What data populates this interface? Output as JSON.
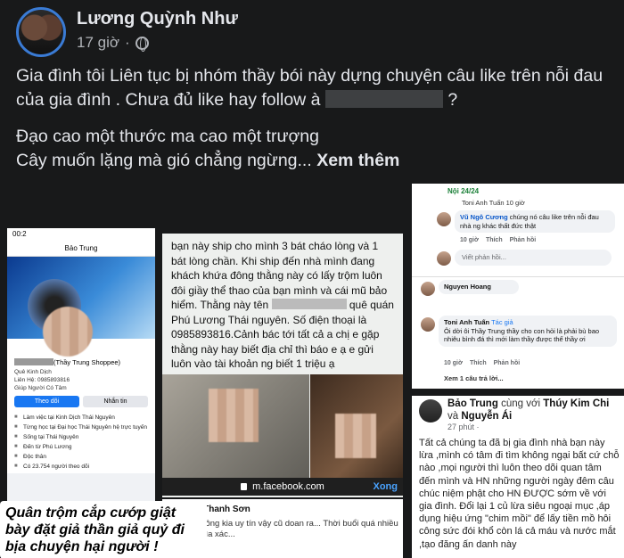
{
  "post": {
    "author": "Lương Quỳnh Như",
    "time": "17 giờ",
    "separator": "·",
    "text_line1_a": "Gia đình tôi  Liên tục bị nhóm thầy bói này dựng chuyện câu like trên nỗi đau của gia đình . Chưa đủ like hay follow à",
    "text_line1_b": "?",
    "text_line2": "Đạo cao một thước ma cao một trượng",
    "text_line3": "Cây muốn lặng mà gió chẳng ngừng...",
    "see_more": "Xem thêm"
  },
  "phone_screenshot": {
    "status_time": "00:2",
    "title": "Bảo Trung",
    "name_suffix": "(Thầy Trung Shoppee)",
    "info": [
      "Quê Kinh Dịch",
      "Liên Hệ: 0985893816",
      "Giúp Người Có Tâm"
    ],
    "follow_label": "Theo dõi",
    "message_label": "Nhắn tin",
    "list": [
      "Làm việc tại Kinh Dịch Thái Nguyên",
      "Từng học tại Đại học Thái Nguyên hệ trực tuyến",
      "Sống tại Thái Nguyên",
      "Đến từ Phú Lương",
      "Độc thân",
      "Có 23.754 người theo dõi"
    ],
    "caption": "Quân trộm cắp cướp giật bày đặt giả thần giả quỷ đi bịa chuyện hại người !"
  },
  "note_screenshot": {
    "text_a": "bạn này ship cho mình 3 bát cháo lòng và 1 bát lòng chần. Khi ship đến nhà mình đang khách khứa đông thằng này có lấy trộm luôn đôi giầy thể thao của bạn mình và cái mũ bảo hiểm. Thằng này tên",
    "text_b": "quê quán Phú Lương Thái nguyên. Số điện thoại là 0985893816.Cảnh bác tới tất cả a chị e gặp thằng này hay biết địa chỉ thì báo e ạ e gửi luôn vào tài khoản ng biết 1 triệu ạ",
    "url": "m.facebook.com",
    "done": "Xong"
  },
  "comment_card": {
    "name": "Cổ Thanh Sơn",
    "text": "mặt ông kia uy tín vậy cũ doan ra... Thời buổi quá nhiều lên rìa xác..."
  },
  "comments_screenshot": {
    "group": "Nội 24/24",
    "top_line": "Toni Anh Tuấn  10 giờ",
    "c1_name": "Vũ Ngô Cương",
    "c1_text": "chúng nó câu like trên nỗi đau nhà ng khác thất đức thật",
    "acts_time": "10 giờ",
    "act_like": "Thích",
    "act_reply": "Phản hồi",
    "reply_placeholder": "Viết phản hồi...",
    "c2_name": "Nguyen Hoang",
    "c3_name": "Toni Anh Tuấn",
    "c3_badge": "Tác giả",
    "c3_text": "Ôi dời ôi Thầy Trung thầy cho con hỏi là phải bù bao nhiêu bình đá thì mới làm thầy được thế thầy ơi",
    "c3_time": "10 giờ",
    "more_replies": "Xem 1 câu trả lời..."
  },
  "fb_post_screenshot": {
    "author": "Bảo Trung",
    "with_text": "cùng với",
    "tag1": "Thúy Kim Chi",
    "and_text": "và",
    "tag2": "Nguyễn Ái",
    "time": "27 phút ·",
    "body": "Tất cả chúng ta đã bị gia đình nhà bạn này lừa ,mình có tâm đi tìm không ngại bất cứ chỗ nào ,mọi người thì luôn theo dõi quan tâm đến mình và HN  những người ngày đêm câu chúc niệm phật cho HN ĐƯỢC sớm về với gia đình. Đổi lại 1 củ lừa siêu ngoại mục ,áp dụng hiệu ứng \"chim mồi\" để lấy tiền mồ hôi công sức đói khổ còn lá cả máu và nước mắt ,tạo đăng ấn danh này"
  },
  "colors": {
    "background": "#18191a",
    "text": "#e4e6eb",
    "muted": "#b0b3b8",
    "link_blue": "#1877f2"
  }
}
